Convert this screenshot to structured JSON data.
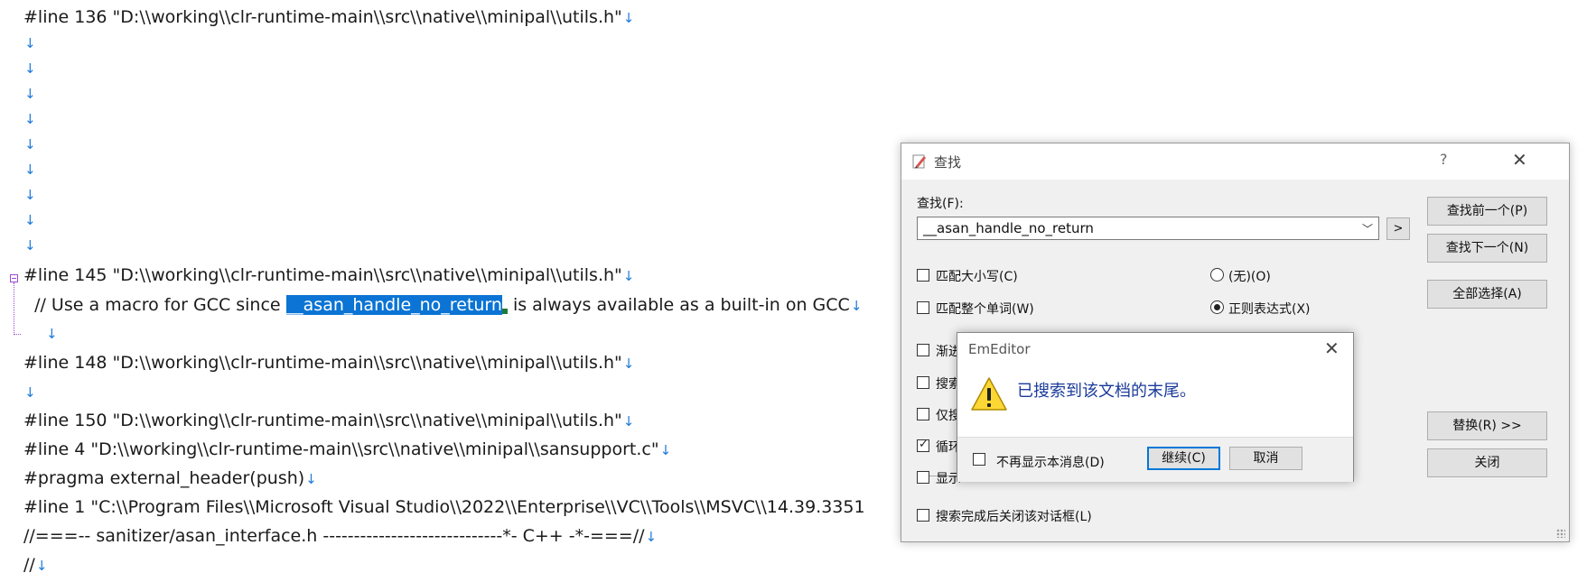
{
  "editor": {
    "return_mark": "↓",
    "lines": [
      "#line 136 \"D:\\\\working\\\\clr-runtime-main\\\\src\\\\native\\\\minipal\\\\utils.h\"",
      "#line 145 \"D:\\\\working\\\\clr-runtime-main\\\\src\\\\native\\\\minipal\\\\utils.h\"",
      "#line 148 \"D:\\\\working\\\\clr-runtime-main\\\\src\\\\native\\\\minipal\\\\utils.h\"",
      "#line 150 \"D:\\\\working\\\\clr-runtime-main\\\\src\\\\native\\\\minipal\\\\utils.h\"",
      "#line 4 \"D:\\\\working\\\\clr-runtime-main\\\\src\\\\native\\\\minipal\\\\sansupport.c\"",
      "#pragma external_header(push)",
      "#line 1 \"C:\\\\Program Files\\\\Microsoft Visual Studio\\\\2022\\\\Enterprise\\\\VC\\\\Tools\\\\MSVC\\\\14.39.3351",
      "//===-- sanitizer/asan_interface.h -----------------------------*- C++ -*-===//",
      "//"
    ],
    "comment_before": "  // Use a macro for GCC since ",
    "comment_match": "__asan_handle_no_return",
    "comment_after": " is always available as a built-in on GCC"
  },
  "find_dialog": {
    "title": "查找",
    "help": "?",
    "close": "✕",
    "find_label": "查找(F):",
    "search_value": "__asan_handle_no_return",
    "more": ">",
    "options": [
      {
        "label": "匹配大小写(C)",
        "checked": false
      },
      {
        "label": "匹配整个单词(W)",
        "checked": false
      },
      {
        "label": "渐进",
        "checked": false
      },
      {
        "label": "搜索",
        "checked": false
      },
      {
        "label": "仅搜",
        "checked": false
      },
      {
        "label": "循环",
        "checked": true
      },
      {
        "label": "显示",
        "checked": false
      },
      {
        "label": "搜索完成后关闭该对话框(L)",
        "checked": false
      }
    ],
    "radio_none": "(无)(O)",
    "radio_regex": "正则表达式(X)",
    "buttons": {
      "find_prev": "查找前一个(P)",
      "find_next": "查找下一个(N)",
      "select_all": "全部选择(A)",
      "replace": "替换(R) >>",
      "close": "关闭"
    }
  },
  "message_box": {
    "title": "EmEditor",
    "close": "✕",
    "message": "已搜索到该文档的末尾。",
    "dont_show": "不再显示本消息(D)",
    "continue": "继续(C)",
    "cancel": "取消"
  },
  "colors": {
    "selection": "#0b74d4",
    "return_mark": "#1f7ad8",
    "fold_marker": "#9a4bd0",
    "message_text": "#1a3a9a"
  }
}
